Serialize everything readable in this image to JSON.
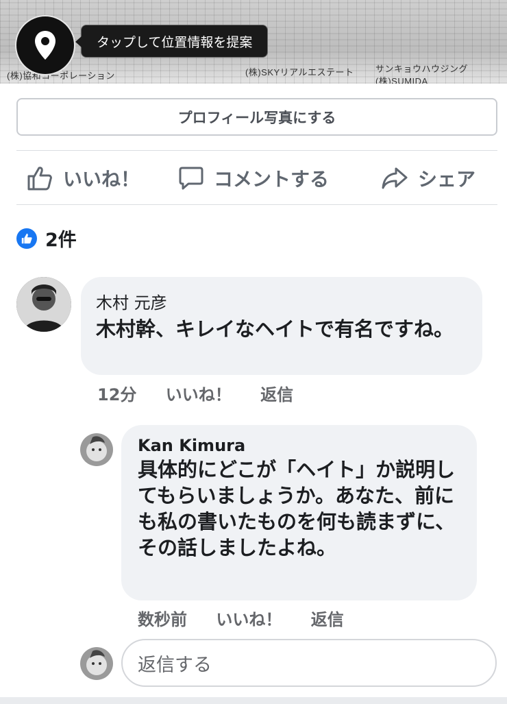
{
  "photo": {
    "tooltip": "タップして位置情報を提案",
    "newspaper_lines": [
      "(株)協和コーポレーション",
      "(株)SKYリアルエステート",
      "サンキョウハウジング",
      "(株)SUMIDA"
    ]
  },
  "profile_button": {
    "label": "プロフィール写真にする"
  },
  "actions": {
    "like": "いいね！",
    "comment": "コメントする",
    "share": "シェア"
  },
  "reactions": {
    "count": "2件"
  },
  "comments": [
    {
      "author": "木村 元彦",
      "text": "木村幹、キレイなヘイトで有名ですね。",
      "time": "12分",
      "like": "いいね！",
      "reply": "返信"
    },
    {
      "author": "Kan Kimura",
      "text": "具体的にどこが「ヘイト」か説明してもらいましょうか。あなた、前にも私の書いたものを何も読まずに、その話しましたよね。",
      "time": "数秒前",
      "like": "いいね！",
      "reply": "返信"
    }
  ],
  "reply_box": {
    "placeholder": "返信する"
  },
  "colors": {
    "accent": "#1877f2",
    "bubble": "#f0f2f5",
    "meta": "#65676b"
  }
}
